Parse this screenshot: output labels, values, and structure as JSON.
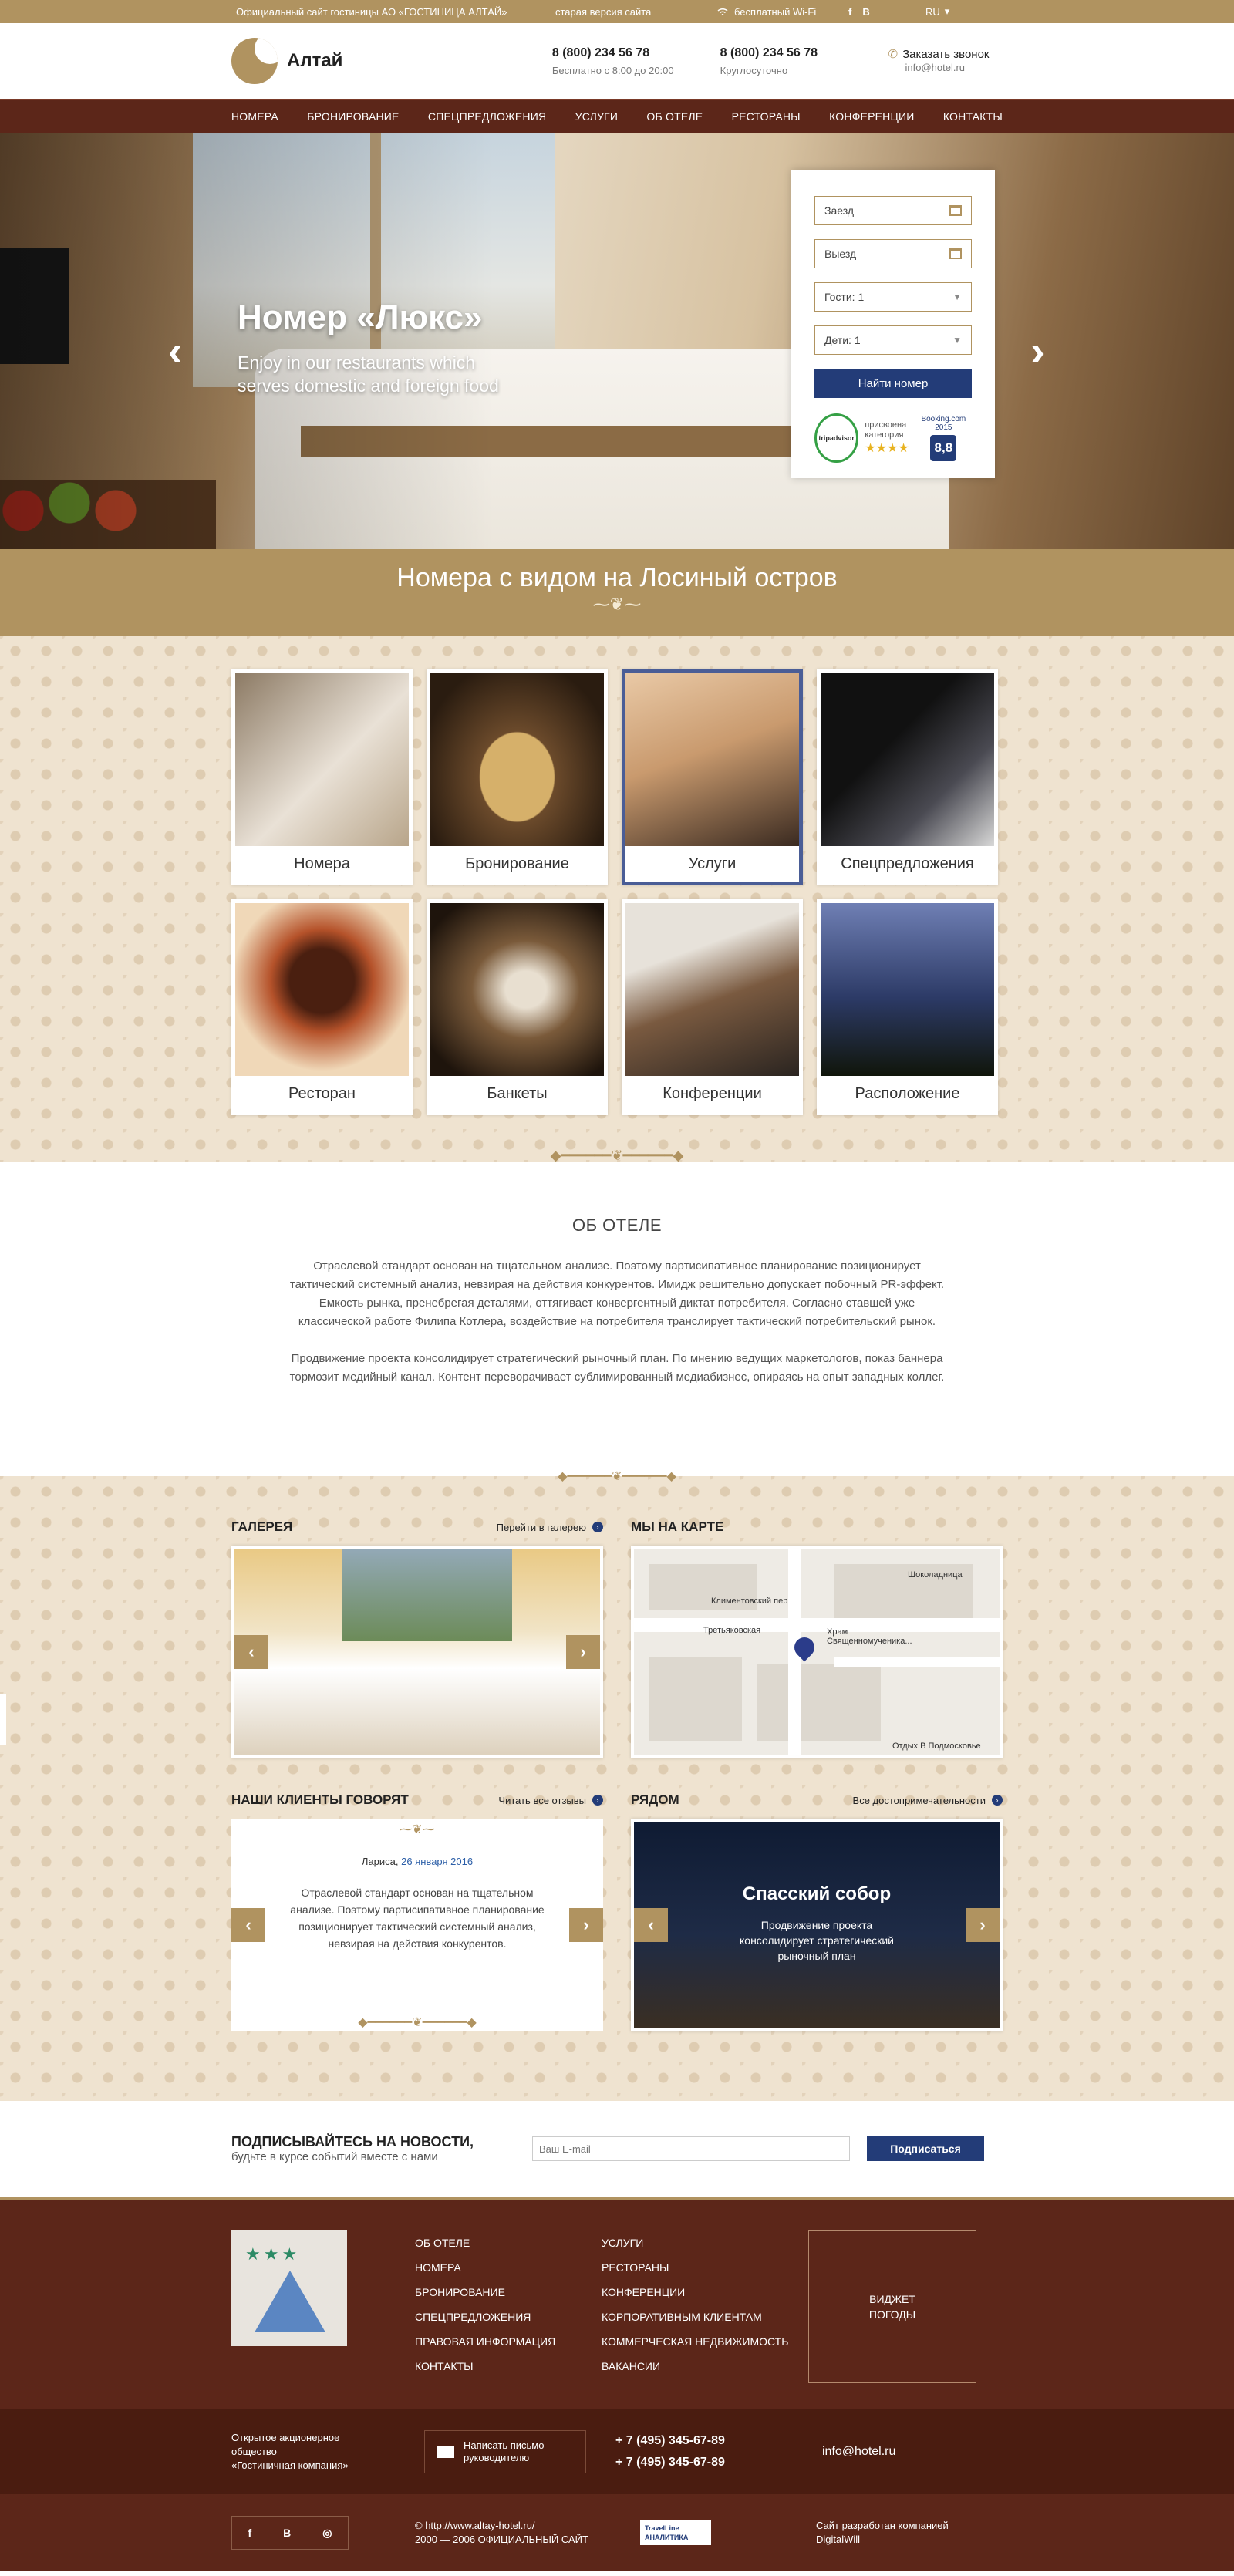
{
  "topbar": {
    "official": "Официальный сайт гостиницы АО «ГОСТИНИЦА АЛТАЙ»",
    "old_version": "старая версия сайта",
    "wifi": "бесплатный Wi-Fi",
    "social": [
      "f",
      "B"
    ],
    "lang": "RU"
  },
  "header": {
    "brand": "Алтай",
    "phone1": {
      "number": "8 (800) 234 56 78",
      "note": "Бесплатно с 8:00 до 20:00"
    },
    "phone2": {
      "number": "8 (800) 234 56 78",
      "note": "Круглосуточно"
    },
    "callback": "Заказать звонок",
    "email": "info@hotel.ru"
  },
  "nav": [
    "НОМЕРА",
    "БРОНИРОВАНИЕ",
    "СПЕЦПРЕДЛОЖЕНИЯ",
    "УСЛУГИ",
    "ОБ ОТЕЛЕ",
    "РЕСТОРАНЫ",
    "КОНФЕРЕНЦИИ",
    "КОНТАКТЫ"
  ],
  "hero": {
    "title": "Номер «Люкс»",
    "subtitle_line1": "Enjoy in our restaurants which",
    "subtitle_line2": "serves domestic and foreign food"
  },
  "booking": {
    "checkin": "Заезд",
    "checkout": "Выезд",
    "guests": "Гости: 1",
    "children": "Дети: 1",
    "submit": "Найти номер",
    "tripadvisor": "tripadvisor",
    "category_line1": "присвоена",
    "category_line2": "категория",
    "stars": "★★★★",
    "booking_label": "Booking.com 2015",
    "booking_score": "8,8"
  },
  "band": {
    "title": "Номера с видом на Лосиный остров"
  },
  "tiles": [
    {
      "label": "Номера",
      "color": "#c9b8a0"
    },
    {
      "label": "Бронирование",
      "color": "#6b4a2b"
    },
    {
      "label": "Услуги",
      "color": "#c99a6e"
    },
    {
      "label": "Спецпредложения",
      "color": "#2a2a2e"
    },
    {
      "label": "Ресторан",
      "color": "#6e3418"
    },
    {
      "label": "Банкеты",
      "color": "#3b2a1c"
    },
    {
      "label": "Конференции",
      "color": "#7a5a40"
    },
    {
      "label": "Расположение",
      "color": "#2c3a66"
    }
  ],
  "about": {
    "title": "ОБ ОТЕЛЕ",
    "p1": "Отраслевой стандарт основан на тщательном анализе. Поэтому партисипативное планирование позиционирует тактический системный анализ, невзирая на действия конкурентов. Имидж решительно допускает побочный PR-эффект. Емкость рынка, пренебрегая деталями, оттягивает конвергентный диктат потребителя. Согласно ставшей уже классической работе Филипа Котлера, воздействие на потребителя транслирует тактический потребительский рынок.",
    "p2": "Продвижение проекта консолидирует стратегический рыночный план. По мнению ведущих маркетологов, показ баннера тормозит медийный канал. Контент переворачивает сублимированный медиабизнес, опираясь на опыт западных коллег."
  },
  "gallery": {
    "title": "ГАЛЕРЕЯ",
    "link": "Перейти в галерею"
  },
  "map": {
    "title": "МЫ НА КАРТЕ",
    "labels": [
      "Шоколадница",
      "Климентовский пер",
      "Третьяковская",
      "Храм Священномученика...",
      "Отдых В Подмосковье"
    ]
  },
  "reviews": {
    "title": "НАШИ КЛИЕНТЫ ГОВОРЯТ",
    "link": "Читать все отзывы",
    "author": "Лариса,",
    "date": "26 января 2016",
    "text": "Отраслевой стандарт основан на тщательном анализе. Поэтому партисипативное планирование позиционирует тактический системный анализ, невзирая на действия конкурентов."
  },
  "nearby": {
    "title": "РЯДОМ",
    "link": "Все достопримечательности",
    "place": "Спасский собор",
    "text": "Продвижение проекта консолидирует стратегический рыночный план"
  },
  "subscribe": {
    "title": "ПОДПИСЫВАЙТЕСЬ НА НОВОСТИ,",
    "subtitle": "будьте в курсе событий вместе с нами",
    "placeholder": "Ваш E-mail",
    "button": "Подписаться"
  },
  "footer": {
    "links_a": [
      "ОБ ОТЕЛЕ",
      "НОМЕРА",
      "БРОНИРОВАНИЕ",
      "СПЕЦПРЕДЛОЖЕНИЯ",
      "ПРАВОВАЯ ИНФОРМАЦИЯ",
      "КОНТАКТЫ"
    ],
    "links_b": [
      "УСЛУГИ",
      "РЕСТОРАНЫ",
      "КОНФЕРЕНЦИИ",
      "КОРПОРАТИВНЫМ КЛИЕНТАМ",
      "КОММЕРЧЕСКАЯ НЕДВИЖИМОСТЬ",
      "ВАКАНСИИ"
    ],
    "widget_line1": "ВИДЖЕТ",
    "widget_line2": "ПОГОДЫ",
    "org_line1": "Открытое акционерное",
    "org_line2": "общество",
    "org_line3": "«Гостиничная компания»",
    "write_line1": "Написать письмо",
    "write_line2": "руководителю",
    "phone1": "+ 7 (495) 345-67-89",
    "phone2": "+ 7 (495) 345-67-89",
    "email": "info@hotel.ru",
    "social": [
      "f",
      "B",
      "◎"
    ],
    "url": "© http://www.altay-hotel.ru/",
    "years": "2000 — 2006  ОФИЦИАЛЬНЫЙ САЙТ",
    "travelline_line1": "TravelLine",
    "travelline_line2": "АНАЛИТИКА",
    "dev_line1": "Сайт разработан компанией",
    "dev_line2": "DigitalWill"
  }
}
